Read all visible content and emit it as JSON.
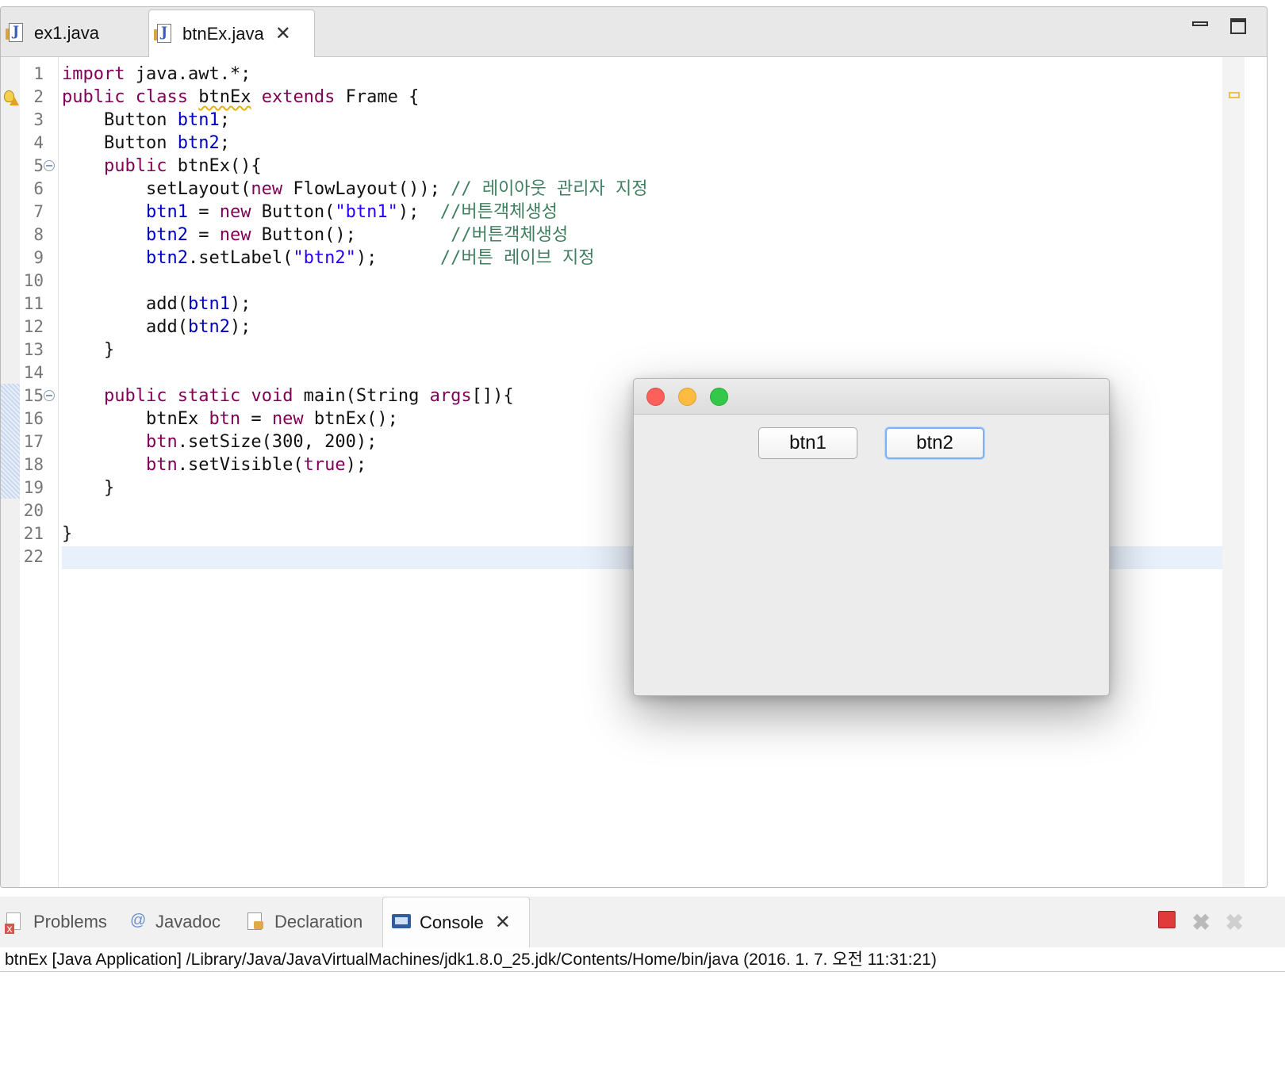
{
  "editor": {
    "tabs": [
      {
        "label": "ex1.java",
        "active": false
      },
      {
        "label": "btnEx.java",
        "active": true
      }
    ],
    "lines": [
      {
        "n": "1",
        "segments": [
          {
            "t": "import",
            "c": "kw"
          },
          {
            "t": " java.awt.*;",
            "c": ""
          }
        ]
      },
      {
        "n": "2",
        "segments": [
          {
            "t": "public",
            "c": "kw"
          },
          {
            "t": " ",
            "c": ""
          },
          {
            "t": "class",
            "c": "kw"
          },
          {
            "t": " ",
            "c": ""
          },
          {
            "t": "btnEx",
            "c": "warnu"
          },
          {
            "t": " ",
            "c": ""
          },
          {
            "t": "extends",
            "c": "kw"
          },
          {
            "t": " Frame {",
            "c": ""
          }
        ]
      },
      {
        "n": "3",
        "segments": [
          {
            "t": "    Button ",
            "c": ""
          },
          {
            "t": "btn1",
            "c": "fld"
          },
          {
            "t": ";",
            "c": ""
          }
        ]
      },
      {
        "n": "4",
        "segments": [
          {
            "t": "    Button ",
            "c": ""
          },
          {
            "t": "btn2",
            "c": "fld"
          },
          {
            "t": ";",
            "c": ""
          }
        ]
      },
      {
        "n": "5",
        "segments": [
          {
            "t": "    ",
            "c": ""
          },
          {
            "t": "public",
            "c": "kw"
          },
          {
            "t": " btnEx(){",
            "c": ""
          }
        ]
      },
      {
        "n": "6",
        "segments": [
          {
            "t": "        setLayout(",
            "c": ""
          },
          {
            "t": "new",
            "c": "kw"
          },
          {
            "t": " FlowLayout()); ",
            "c": ""
          },
          {
            "t": "// 레이아웃 관리자 지정",
            "c": "cmt"
          }
        ]
      },
      {
        "n": "7",
        "segments": [
          {
            "t": "        ",
            "c": ""
          },
          {
            "t": "btn1",
            "c": "fld"
          },
          {
            "t": " = ",
            "c": ""
          },
          {
            "t": "new",
            "c": "kw"
          },
          {
            "t": " Button(",
            "c": ""
          },
          {
            "t": "\"btn1\"",
            "c": "str"
          },
          {
            "t": ");  ",
            "c": ""
          },
          {
            "t": "//버튼객체생성",
            "c": "cmt"
          }
        ]
      },
      {
        "n": "8",
        "segments": [
          {
            "t": "        ",
            "c": ""
          },
          {
            "t": "btn2",
            "c": "fld"
          },
          {
            "t": " = ",
            "c": ""
          },
          {
            "t": "new",
            "c": "kw"
          },
          {
            "t": " Button();         ",
            "c": ""
          },
          {
            "t": "//버튼객체생성",
            "c": "cmt"
          }
        ]
      },
      {
        "n": "9",
        "segments": [
          {
            "t": "        ",
            "c": ""
          },
          {
            "t": "btn2",
            "c": "fld"
          },
          {
            "t": ".setLabel(",
            "c": ""
          },
          {
            "t": "\"btn2\"",
            "c": "str"
          },
          {
            "t": ");      ",
            "c": ""
          },
          {
            "t": "//버튼 레이브 지정",
            "c": "cmt"
          }
        ]
      },
      {
        "n": "10",
        "segments": []
      },
      {
        "n": "11",
        "segments": [
          {
            "t": "        add(",
            "c": ""
          },
          {
            "t": "btn1",
            "c": "fld"
          },
          {
            "t": ");",
            "c": ""
          }
        ]
      },
      {
        "n": "12",
        "segments": [
          {
            "t": "        add(",
            "c": ""
          },
          {
            "t": "btn2",
            "c": "fld"
          },
          {
            "t": ");",
            "c": ""
          }
        ]
      },
      {
        "n": "13",
        "segments": [
          {
            "t": "    }",
            "c": ""
          }
        ]
      },
      {
        "n": "14",
        "segments": []
      },
      {
        "n": "15",
        "segments": [
          {
            "t": "    ",
            "c": ""
          },
          {
            "t": "public",
            "c": "kw"
          },
          {
            "t": " ",
            "c": ""
          },
          {
            "t": "static",
            "c": "kw"
          },
          {
            "t": " ",
            "c": ""
          },
          {
            "t": "void",
            "c": "kw"
          },
          {
            "t": " main(String ",
            "c": ""
          },
          {
            "t": "args",
            "c": "kw"
          },
          {
            "t": "[]){",
            "c": ""
          }
        ]
      },
      {
        "n": "16",
        "segments": [
          {
            "t": "        btnEx ",
            "c": ""
          },
          {
            "t": "btn",
            "c": "kw"
          },
          {
            "t": " = ",
            "c": ""
          },
          {
            "t": "new",
            "c": "kw"
          },
          {
            "t": " btnEx();",
            "c": ""
          }
        ]
      },
      {
        "n": "17",
        "segments": [
          {
            "t": "        ",
            "c": ""
          },
          {
            "t": "btn",
            "c": "kw"
          },
          {
            "t": ".setSize(300, 200);",
            "c": ""
          }
        ]
      },
      {
        "n": "18",
        "segments": [
          {
            "t": "        ",
            "c": ""
          },
          {
            "t": "btn",
            "c": "kw"
          },
          {
            "t": ".setVisible(",
            "c": ""
          },
          {
            "t": "true",
            "c": "kw"
          },
          {
            "t": ");",
            "c": ""
          }
        ]
      },
      {
        "n": "19",
        "segments": [
          {
            "t": "    }",
            "c": ""
          }
        ]
      },
      {
        "n": "20",
        "segments": []
      },
      {
        "n": "21",
        "segments": [
          {
            "t": "}",
            "c": ""
          }
        ]
      },
      {
        "n": "22",
        "segments": []
      }
    ]
  },
  "awt_window": {
    "buttons": [
      {
        "label": "btn1"
      },
      {
        "label": "btn2"
      }
    ]
  },
  "bottom_panel": {
    "tabs": [
      {
        "label": "Problems",
        "icon": "problems-icon"
      },
      {
        "label": "Javadoc",
        "icon": "javadoc-icon",
        "glyph": "@"
      },
      {
        "label": "Declaration",
        "icon": "declaration-icon"
      },
      {
        "label": "Console",
        "icon": "console-icon",
        "active": true
      }
    ],
    "console_status": "btnEx [Java Application] /Library/Java/JavaVirtualMachines/jdk1.8.0_25.jdk/Contents/Home/bin/java (2016. 1. 7. 오전 11:31:21)"
  },
  "colors": {
    "keyword": "#7f0055",
    "field": "#0000c0",
    "string": "#2a00ff",
    "comment": "#3f7f5f",
    "current_line": "#e8f0fb"
  }
}
